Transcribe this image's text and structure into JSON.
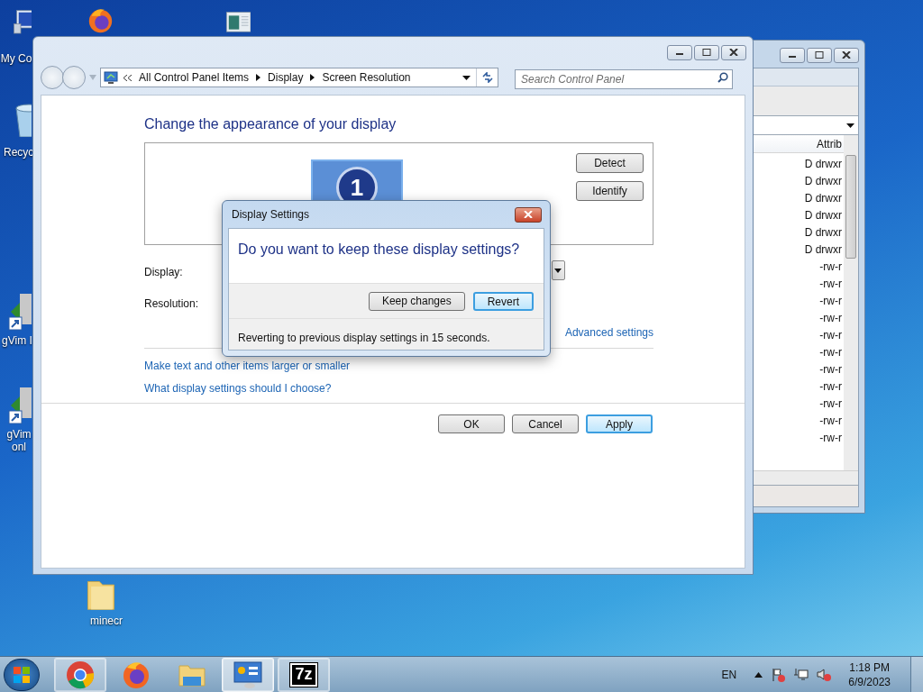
{
  "desktop_icons": [
    {
      "kind": "computer",
      "label": "My Co"
    },
    {
      "kind": "browser"
    },
    {
      "kind": "window"
    },
    {
      "kind": "recycle",
      "label": "Recyc"
    },
    {
      "kind": "vim",
      "label": "gVim I"
    },
    {
      "kind": "vim",
      "label": "gVim onl"
    },
    {
      "kind": "folder",
      "label": "minecr"
    }
  ],
  "back_window": {
    "column_header": "Attrib",
    "rows": [
      "D drwxr",
      "D drwxr",
      "D drwxr",
      "D drwxr",
      "D drwxr",
      "D drwxr",
      "-rw-r",
      "-rw-r",
      "-rw-r",
      "-rw-r",
      "-rw-r",
      "-rw-r",
      "-rw-r",
      "-rw-r",
      "-rw-r",
      "-rw-r",
      "-rw-r"
    ]
  },
  "main_window": {
    "breadcrumb": [
      "All Control Panel Items",
      "Display",
      "Screen Resolution"
    ],
    "search": {
      "placeholder": "Search Control Panel"
    },
    "heading": "Change the appearance of your display",
    "monitor_number": "1",
    "side_buttons": [
      "Detect",
      "Identify"
    ],
    "fields": [
      {
        "label": "Display:"
      },
      {
        "label": "Resolution:"
      }
    ],
    "advanced_link": "Advanced settings",
    "links": [
      "Make text and other items larger or smaller",
      "What display settings should I choose?"
    ],
    "buttons": [
      {
        "label": "OK",
        "default": false
      },
      {
        "label": "Cancel",
        "default": false
      },
      {
        "label": "Apply",
        "default": true
      }
    ]
  },
  "dialog": {
    "title": "Display Settings",
    "question": "Do you want to keep these display settings?",
    "buttons": [
      {
        "label": "Keep changes",
        "default": false
      },
      {
        "label": "Revert",
        "default": true
      }
    ],
    "footer": "Reverting to previous display settings in 15 seconds."
  },
  "taskbar": {
    "items": [
      {
        "kind": "chrome",
        "running": true,
        "selected": false
      },
      {
        "kind": "firefox",
        "running": false,
        "selected": false
      },
      {
        "kind": "explorer",
        "running": false,
        "selected": false
      },
      {
        "kind": "control-panel",
        "running": true,
        "selected": true
      },
      {
        "kind": "archiver",
        "running": true,
        "selected": false,
        "text": "7z"
      }
    ],
    "language": "EN",
    "time": "1:18 PM",
    "date": "6/9/2023"
  }
}
